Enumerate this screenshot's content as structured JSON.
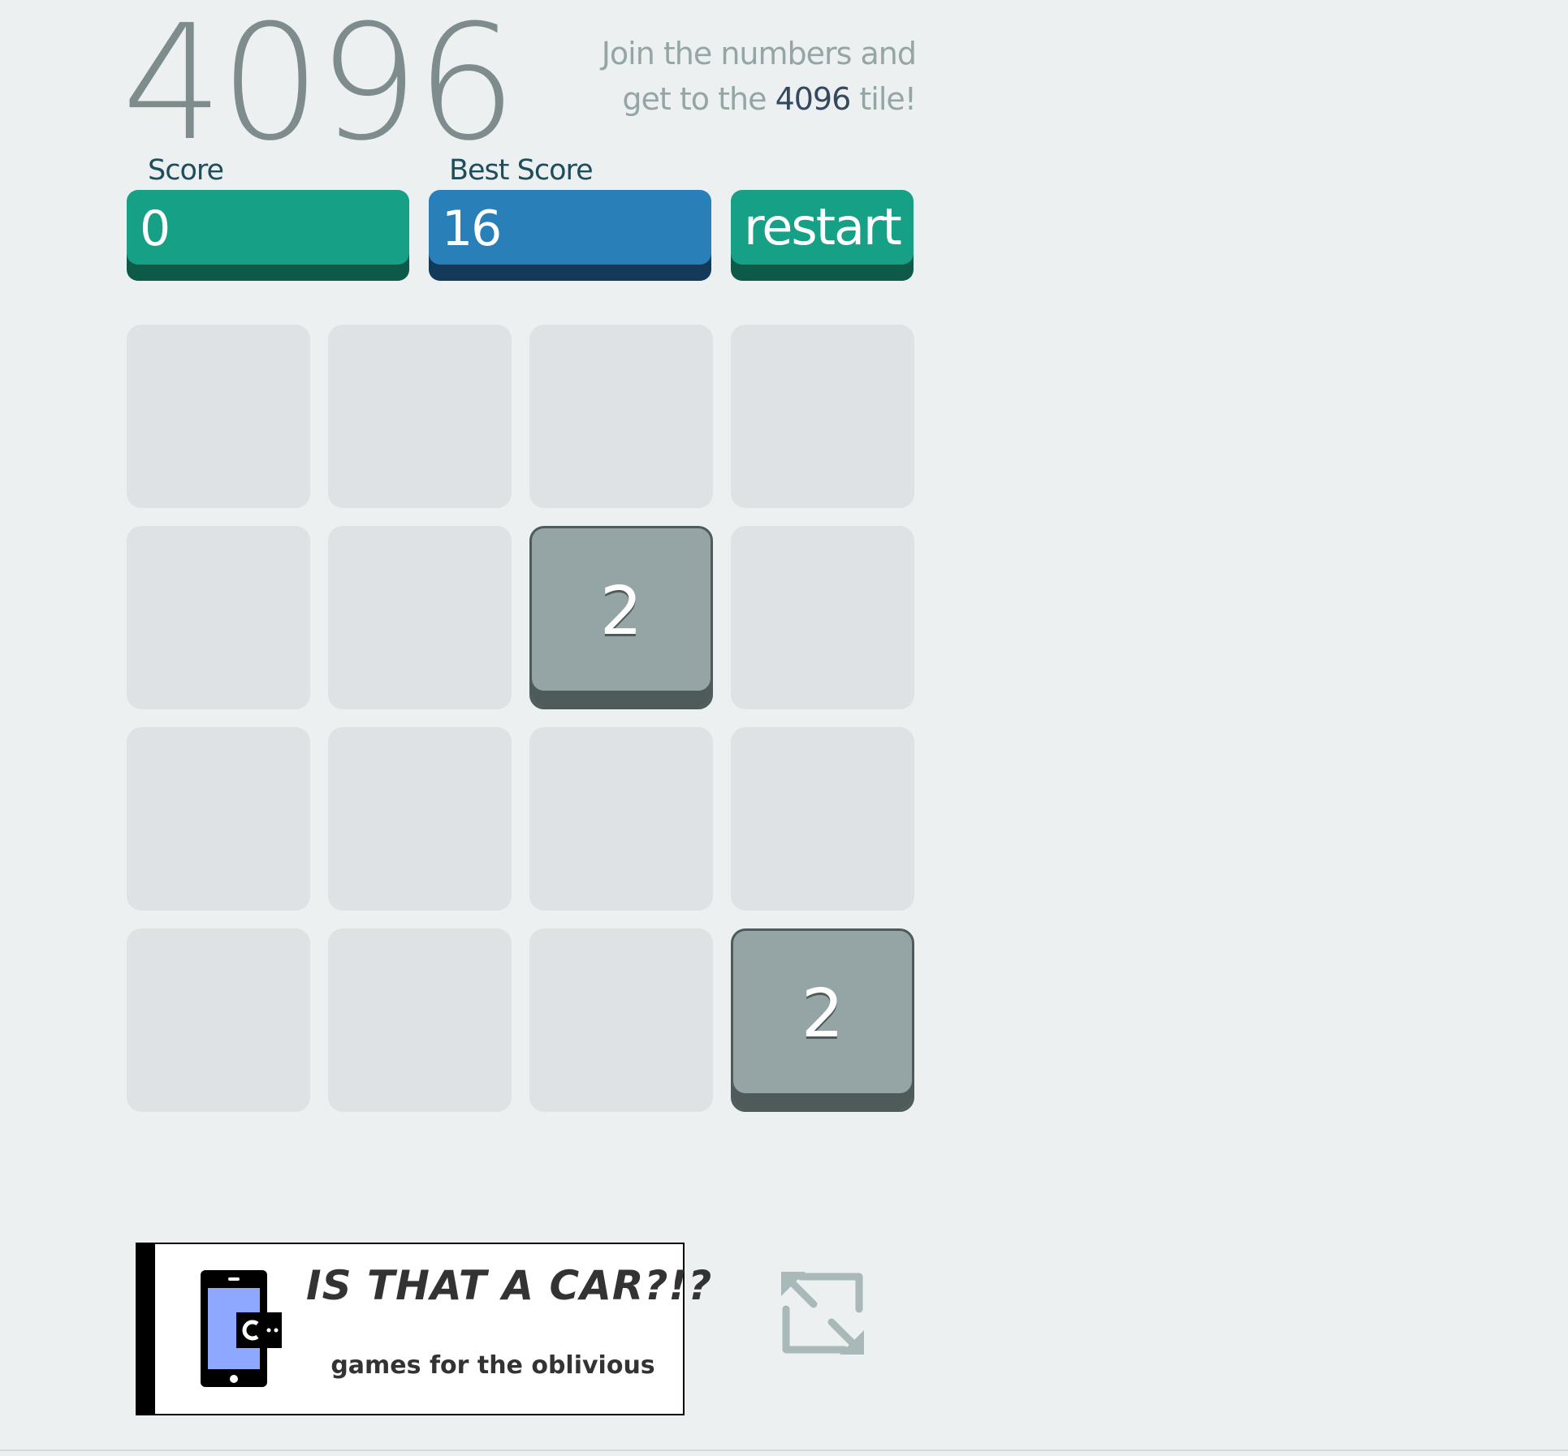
{
  "game": {
    "title": "4096",
    "tagline_pre": "Join the numbers and get to the",
    "tagline_target": "4096",
    "tagline_post": " tile!"
  },
  "scores": {
    "score_label": "Score",
    "score_value": "0",
    "best_label": "Best Score",
    "best_value": "16",
    "restart_label": "restart"
  },
  "colors": {
    "score_green": "#16a085",
    "best_blue": "#2980b9",
    "tile_2": "#95a5a6",
    "empty_cell": "#dfe2e4",
    "background": "#edf0f1"
  },
  "board": {
    "size": 4,
    "tiles": [
      {
        "row": 1,
        "col": 2,
        "value": "2"
      },
      {
        "row": 3,
        "col": 3,
        "value": "2"
      }
    ]
  },
  "banner": {
    "headline": "IS THAT A CAR?!?",
    "subtitle": "games for the oblivious",
    "icon": "phone-icon"
  },
  "controls": {
    "fullscreen_icon": "fullscreen-icon"
  }
}
